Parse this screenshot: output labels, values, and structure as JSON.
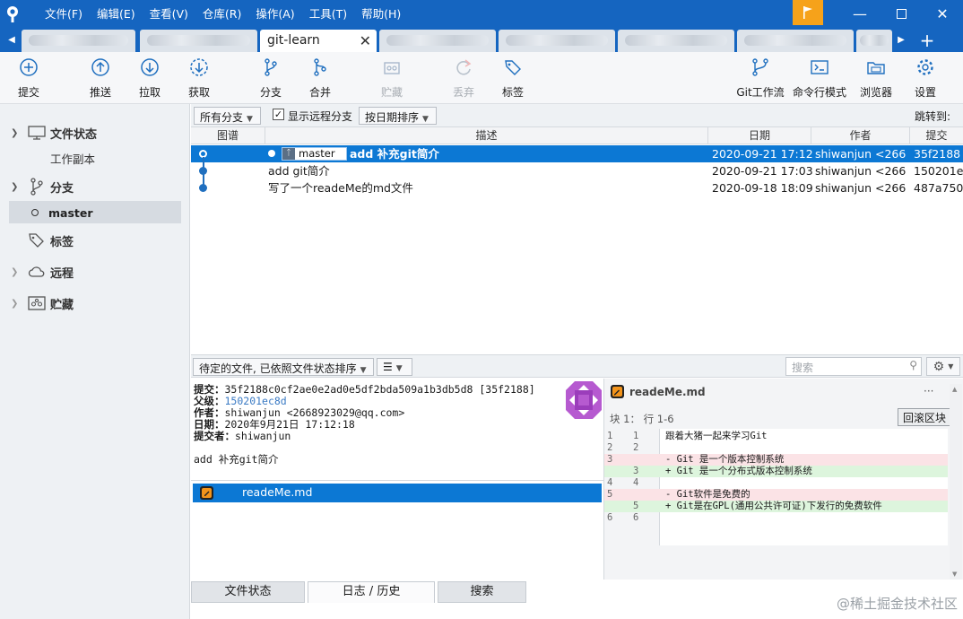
{
  "menu": [
    "文件(F)",
    "编辑(E)",
    "查看(V)",
    "仓库(R)",
    "操作(A)",
    "工具(T)",
    "帮助(H)"
  ],
  "tabs": {
    "active_label": "git-learn"
  },
  "toolbar": {
    "commit": "提交",
    "push": "推送",
    "pull": "拉取",
    "fetch": "获取",
    "branch": "分支",
    "merge": "合并",
    "stash": "贮藏",
    "discard": "丢弃",
    "tag": "标签",
    "git_flow": "Git工作流",
    "terminal": "命令行模式",
    "explorer": "浏览器",
    "settings": "设置"
  },
  "sidebar": {
    "file_status": "文件状态",
    "working_copy": "工作副本",
    "branches": "分支",
    "branch_master": "master",
    "tags": "标签",
    "remotes": "远程",
    "stashes": "贮藏"
  },
  "filter": {
    "all_branches": "所有分支",
    "show_remote": "显示远程分支",
    "sort_by_date": "按日期排序",
    "jump_to": "跳转到:"
  },
  "commit_table": {
    "headers": {
      "graph": "图谱",
      "description": "描述",
      "date": "日期",
      "author": "作者",
      "commit": "提交"
    },
    "rows": [
      {
        "branch": "master",
        "description": "add 补充git简介",
        "date": "2020-09-21 17:12",
        "author": "shiwanjun <2668",
        "hash": "35f2188"
      },
      {
        "description": "add git简介",
        "date": "2020-09-21 17:03",
        "author": "shiwanjun <2668",
        "hash": "150201e"
      },
      {
        "description": "写了一个readeMe的md文件",
        "date": "2020-09-18 18:09",
        "author": "shiwanjun <2668",
        "hash": "487a750"
      }
    ]
  },
  "midbar": {
    "sort_dropdown": "待定的文件, 已依照文件状态排序",
    "search_placeholder": "搜索"
  },
  "details": {
    "commit_label": "提交：",
    "commit_value": "35f2188c0cf2ae0e2ad0e5df2bda509a1b3db5d8 [35f2188]",
    "parent_label": "父级：",
    "parent_value": "150201ec8d",
    "author_label": "作者：",
    "author_value": "shiwanjun <2668923029@qq.com>",
    "date_label": "日期：",
    "date_value": "2020年9月21日 17:12:18",
    "committer_label": "提交者：",
    "committer_value": "shiwanjun",
    "message": "add 补充git简介"
  },
  "files": [
    "readeMe.md"
  ],
  "diff": {
    "file": "readeMe.md",
    "more": "···",
    "hunk": "块 1： 行 1-6",
    "revert": "回滚区块",
    "lines": [
      {
        "type": "ctx",
        "old": "1",
        "new": "1",
        "text": "  跟着大猪一起来学习Git"
      },
      {
        "type": "ctx",
        "old": "2",
        "new": "2",
        "text": ""
      },
      {
        "type": "del",
        "old": "3",
        "new": "",
        "text": "- Git 是一个版本控制系统"
      },
      {
        "type": "add",
        "old": "",
        "new": "3",
        "text": "+ Git 是一个分布式版本控制系统"
      },
      {
        "type": "ctx",
        "old": "4",
        "new": "4",
        "text": ""
      },
      {
        "type": "del",
        "old": "5",
        "new": "",
        "text": "- Git软件是免费的"
      },
      {
        "type": "add",
        "old": "",
        "new": "5",
        "text": "+ Git是在GPL(通用公共许可证)下发行的免费软件"
      },
      {
        "type": "ctx",
        "old": "6",
        "new": "6",
        "text": ""
      }
    ]
  },
  "bottom_tabs": {
    "file_status": "文件状态",
    "log_history": "日志 / 历史",
    "search": "搜索"
  },
  "watermark": "@稀土掘金技术社区",
  "colors": {
    "title_bar": "#1565c0",
    "selection": "#0c78d4",
    "accent_flag": "#f6a21a"
  }
}
